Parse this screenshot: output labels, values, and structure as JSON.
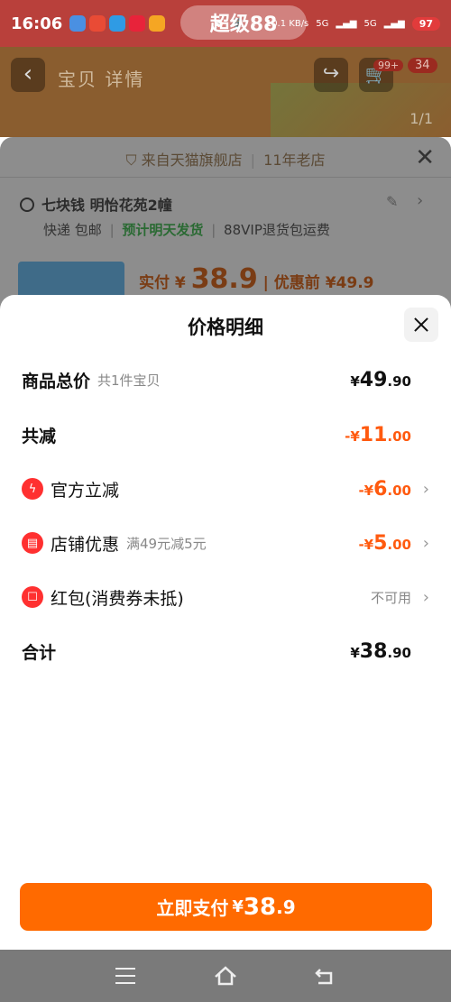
{
  "status_bar": {
    "time": "16:06",
    "banner": "超级88",
    "network_speed": "10.1 KB/s",
    "signal_1": "5G",
    "signal_2": "5G",
    "battery": "97"
  },
  "product_header": {
    "tabs": "宝贝  详情",
    "cart_badge": "99+",
    "message_badge": "34",
    "page_indicator": "1/1"
  },
  "order_card": {
    "source_label": "来自天猫旗舰店",
    "store_age": "11年老店",
    "address": "七块钱 明怡花苑2幢",
    "delivery": "快递 包邮",
    "ship_time": "预计明天发货",
    "return_policy": "88VIP退货包运费",
    "paid_label": "实付",
    "paid_yen": "¥",
    "paid_amount": "38.9",
    "before_discount_label": "优惠前",
    "before_discount_amount": "¥49.9"
  },
  "price_detail": {
    "title": "价格明细",
    "rows": [
      {
        "label": "商品总价",
        "sub": "共1件宝贝",
        "yen": "¥",
        "int": "49",
        "dec": ".90"
      },
      {
        "label": "共减",
        "yen": "-¥",
        "int": "11",
        "dec": ".00"
      },
      {
        "label": "官方立减",
        "icon": "lightning-icon",
        "yen": "-¥",
        "int": "6",
        "dec": ".00"
      },
      {
        "label": "店铺优惠",
        "icon": "shop-icon",
        "sub": "满49元减5元",
        "yen": "-¥",
        "int": "5",
        "dec": ".00"
      },
      {
        "label": "红包(消费券未抵)",
        "icon": "red-envelope-icon",
        "status": "不可用"
      },
      {
        "label": "合计",
        "yen": "¥",
        "int": "38",
        "dec": ".90"
      }
    ]
  },
  "pay_button": {
    "label": "立即支付",
    "yen": "¥",
    "amount": "38",
    "amount_dec": ".9"
  },
  "colors": {
    "accent": "#ff6a00",
    "discount": "#ff5a0f",
    "icon_red": "#ff3030"
  }
}
